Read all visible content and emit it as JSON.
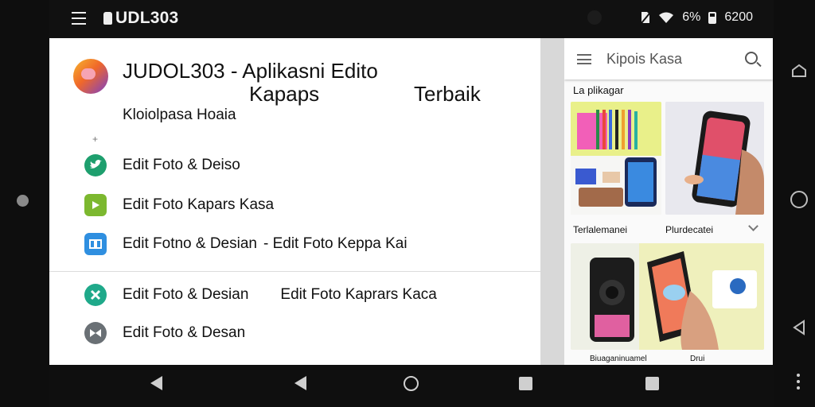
{
  "status_bar": {
    "title": "UDL303",
    "battery_text": "6%",
    "clock": "6200"
  },
  "app": {
    "title_line1": "JUDOL303 - Aplikasni Edito",
    "title_line2a": "Kapaps",
    "title_line2b": "Terbaik",
    "subtitle": "Kloiolpasa Hoaia",
    "plus": "+"
  },
  "menu": [
    {
      "label": "Edit Foto & Deiso",
      "icon": "twitter-bird-icon",
      "color": "#1e9f6e"
    },
    {
      "label": "Edit Foto Kapars Kasa",
      "icon": "play-icon",
      "color": "#7cb82f"
    },
    {
      "label": "Edit Fotno & Desian",
      "label2": "- Edit Foto Keppa Kai",
      "icon": "grid-icon",
      "color": "#2f8fe0"
    },
    {
      "label": "Edit Foto & Desian",
      "label2": "Edit Foto Kaprars Kaca",
      "icon": "star-icon",
      "color": "#1fa98a"
    },
    {
      "label": "Edit Foto & Desan",
      "icon": "bow-tie-icon",
      "color": "#6a7075"
    }
  ],
  "right_panel": {
    "search_text": "Kipois Kasa",
    "section_label": "La plikagar",
    "caption_left": "Terlalemanei",
    "caption_right": "Plurdecatei",
    "bottom_left": "Biuaganinuamel",
    "bottom_right": "Drui"
  },
  "colors": {
    "status_bg": "#111111",
    "panel_bg": "#ffffff",
    "right_bg": "#fafafa"
  }
}
